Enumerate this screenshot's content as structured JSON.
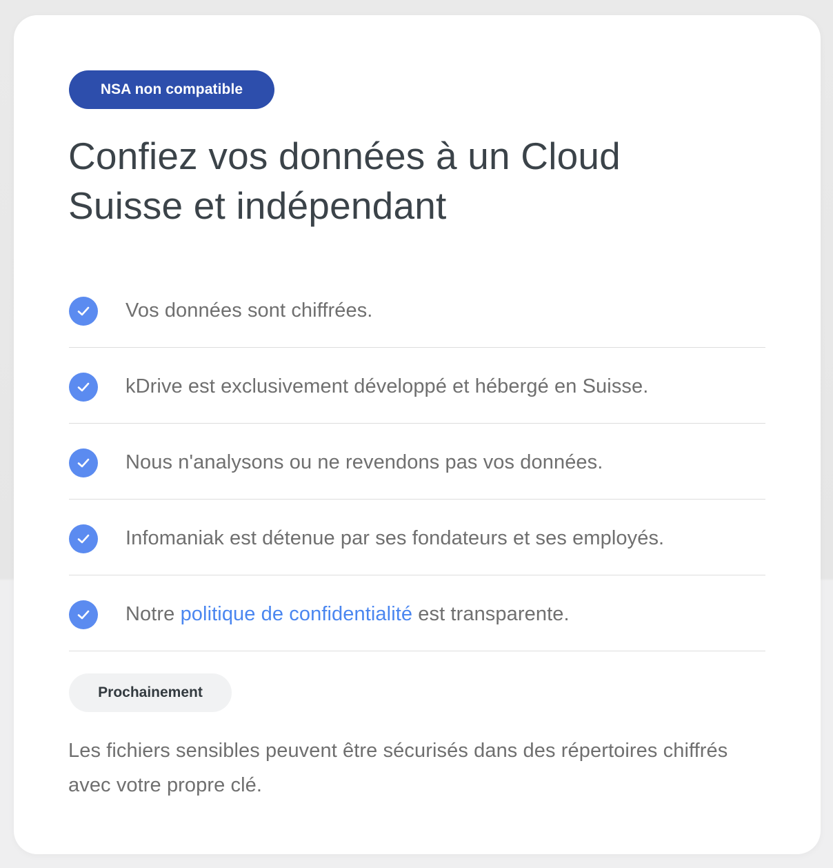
{
  "badge": {
    "label": "NSA non compatible"
  },
  "title": "Confiez vos données à un Cloud Suisse et indépendant",
  "features": [
    {
      "text": "Vos données sont chiffrées."
    },
    {
      "text": "kDrive est exclusivement développé et hébergé en Suisse."
    },
    {
      "text": "Nous n'analysons ou ne revendons pas vos données."
    },
    {
      "text": "Infomaniak est détenue par ses fondateurs et ses employés."
    },
    {
      "before": "Notre ",
      "link": "politique de confidentialité",
      "after": " est transparente."
    }
  ],
  "upcoming": {
    "label": "Prochainement",
    "text": "Les fichiers sensibles peuvent être sécurisés dans des répertoires chiffrés avec votre propre clé."
  },
  "icons": {
    "check": "check-circle-icon"
  },
  "colors": {
    "badge_bg": "#2d4eac",
    "check_bg": "#5b8bf0",
    "link": "#4a86f0",
    "title": "#3b4349",
    "body_text": "#6f6f6f",
    "soon_badge_bg": "#f1f2f3"
  }
}
